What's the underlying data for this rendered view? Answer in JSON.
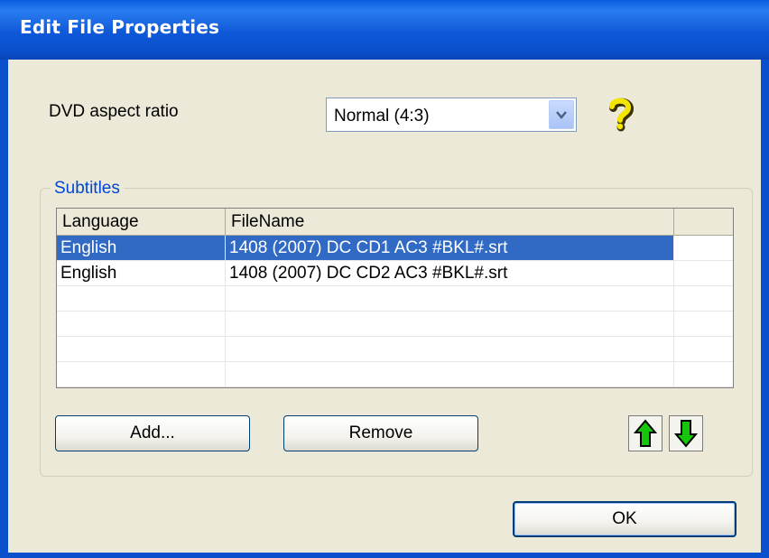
{
  "window": {
    "title": "Edit File Properties"
  },
  "aspect": {
    "label": "DVD aspect ratio",
    "selected": "Normal (4:3)"
  },
  "subtitles": {
    "group_label": "Subtitles",
    "columns": [
      "Language",
      "FileName",
      ""
    ],
    "rows": [
      {
        "language": "English",
        "filename": "1408 (2007) DC CD1 AC3 #BKL#.srt",
        "selected": true
      },
      {
        "language": "English",
        "filename": "1408 (2007) DC CD2 AC3 #BKL#.srt",
        "selected": false
      }
    ],
    "add_label": "Add...",
    "remove_label": "Remove"
  },
  "footer": {
    "ok_label": "OK"
  },
  "icons": {
    "help": "question-mark-icon",
    "up": "arrow-up-icon",
    "down": "arrow-down-icon"
  },
  "colors": {
    "titlebar": "#0a4fcc",
    "selection": "#316ac5",
    "group_label": "#0046d5",
    "arrow_green": "#16c60c"
  }
}
